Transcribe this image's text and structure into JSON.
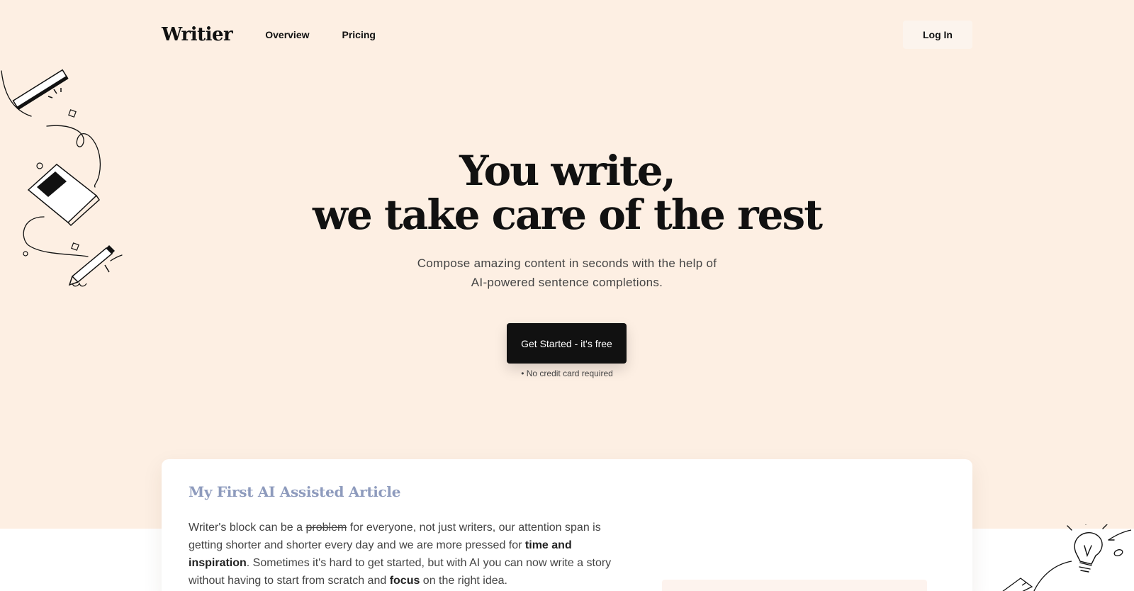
{
  "nav": {
    "logo": "Writier",
    "links": [
      "Overview",
      "Pricing"
    ],
    "login": "Log In"
  },
  "hero": {
    "title_line1": "You write,",
    "title_line2": "we take care of the rest",
    "subtitle_line1": "Compose amazing content in seconds with the help of",
    "subtitle_line2": "AI-powered sentence completions.",
    "cta": "Get Started - it's free",
    "cta_note": "• No credit card required"
  },
  "article": {
    "title": "My First AI Assisted Article",
    "p1_a": "Writer's block can be a ",
    "p1_strike": "problem",
    "p1_b": " for everyone, not just writers, our attention span is getting shorter and shorter every day and we are more pressed for ",
    "p1_bold1": "time and inspiration",
    "p1_c": ". Sometimes it's hard to get started, but with AI you can now write a story without having to start from scratch and ",
    "p1_bold2": "focus",
    "p1_d": " on the right idea."
  },
  "colors": {
    "hero_bg": "#fdefe3",
    "cta_bg": "#111111",
    "article_title": "#8e9bbd"
  },
  "icons": [
    "ruler-icon",
    "notebook-icon",
    "pencil-icon",
    "lightbulb-icon"
  ]
}
